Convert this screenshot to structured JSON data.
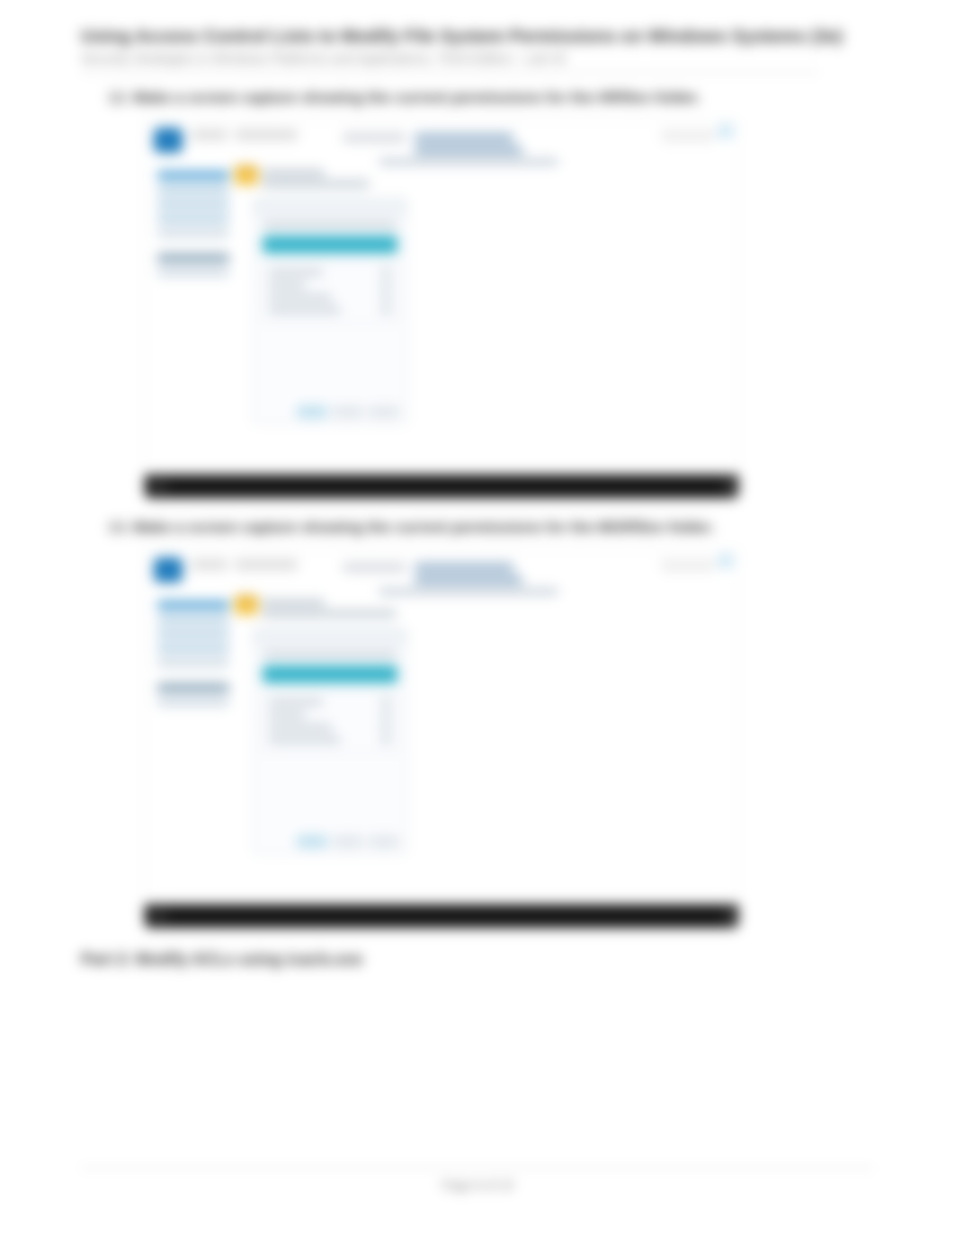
{
  "header": {
    "title": "Using Access Control Lists to Modify File System Permissions on Windows Systems (3e)",
    "subtitle": "Security Strategies in Windows Platforms and Applications, Third Edition - Lab 03"
  },
  "steps": {
    "a": {
      "num": "12.",
      "text": "Make a screen capture showing the current permissions for the HRfiles folder."
    },
    "b": {
      "num": "13.",
      "text": "Make a screen capture showing the current permissions for the MGRfiles folder."
    }
  },
  "part": "Part 2: Modify ACLs using icacls.exe",
  "footer": "Page 6 of 19",
  "dialog": {
    "tabLabel": "Security",
    "objectName": "HRfiles Properties",
    "groupHeader": "Group or user names:",
    "perms": [
      {
        "label": "Full control",
        "allow": "",
        "deny": ""
      },
      {
        "label": "Modify",
        "allow": "",
        "deny": ""
      },
      {
        "label": "Read & execute",
        "allow": "",
        "deny": ""
      },
      {
        "label": "List folder contents",
        "allow": "",
        "deny": ""
      }
    ],
    "buttons": {
      "edit": "Edit...",
      "ok": "OK",
      "cancel": "Cancel",
      "apply": "Apply"
    }
  },
  "explorer": {
    "sidebar": [
      "Quick access",
      "Desktop",
      "Downloads",
      "Documents",
      "Pictures",
      "This PC",
      "Network"
    ],
    "path": "This PC > Local Disk (C:) > LabFiles",
    "search": "Search LabFiles"
  }
}
